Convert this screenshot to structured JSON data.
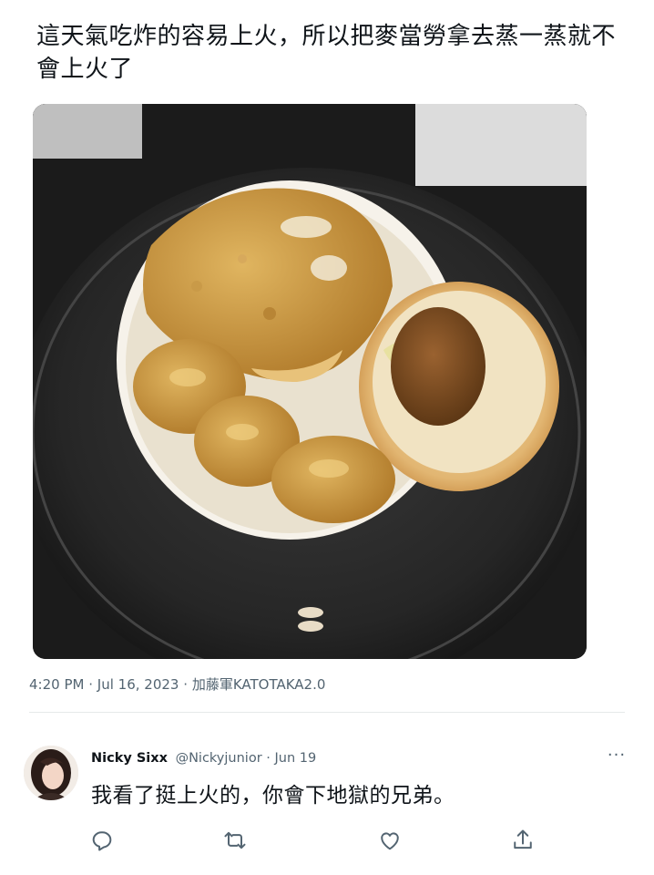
{
  "tweet": {
    "text": "這天氣吃炸的容易上火，所以把麥當勞拿去蒸一蒸就不會上火了",
    "time": "4:20 PM",
    "date": "Jul 16, 2023",
    "source": "加藤軍KATOTAKA2.0",
    "separator": "·",
    "photo_icon": "steamed-mcdonalds-photo"
  },
  "reply": {
    "display_name": "Nicky Sixx",
    "handle": "@Nickyjunior",
    "date": "Jun 19",
    "separator": "·",
    "text": "我看了挺上火的，你會下地獄的兄弟。",
    "more_label": "···",
    "actions": [
      {
        "name": "reply",
        "icon": "comment-icon"
      },
      {
        "name": "retweet",
        "icon": "retweet-icon"
      },
      {
        "name": "like",
        "icon": "heart-icon"
      },
      {
        "name": "share",
        "icon": "share-icon"
      }
    ]
  },
  "colors": {
    "text": "#0f1419",
    "secondary": "#536471",
    "divider": "#e6e9ea"
  }
}
